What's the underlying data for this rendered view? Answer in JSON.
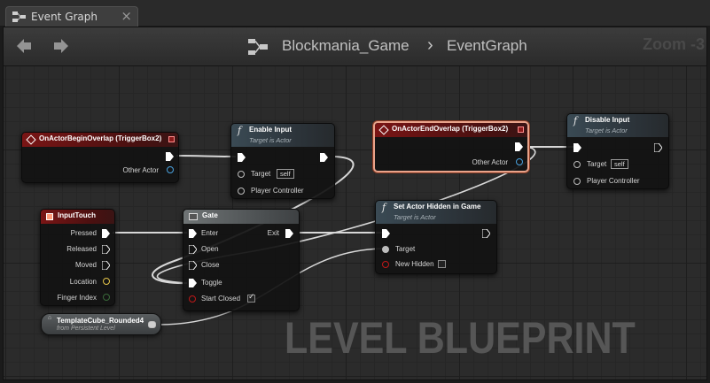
{
  "tab": {
    "label": "Event Graph",
    "icon": "event-graph-icon",
    "close": "×"
  },
  "header": {
    "breadcrumb_game": "Blockmania_Game",
    "breadcrumb_sep": "›",
    "breadcrumb_graph": "EventGraph",
    "zoom": "Zoom -3"
  },
  "watermark": "LEVEL BLUEPRINT",
  "nodes": {
    "on_begin_overlap": {
      "title": "OnActorBeginOverlap (TriggerBox2)",
      "pins": [
        "Other Actor"
      ]
    },
    "enable_input": {
      "title": "Enable Input",
      "subtitle": "Target is Actor",
      "pins": [
        "Target",
        "self",
        "Player Controller"
      ]
    },
    "on_end_overlap": {
      "title": "OnActorEndOverlap (TriggerBox2)",
      "pins": [
        "Other Actor"
      ]
    },
    "disable_input": {
      "title": "Disable Input",
      "subtitle": "Target is Actor",
      "pins": [
        "Target",
        "self",
        "Player Controller"
      ]
    },
    "input_touch": {
      "title": "InputTouch",
      "pins": [
        "Pressed",
        "Released",
        "Moved",
        "Location",
        "Finger Index"
      ]
    },
    "gate": {
      "title": "Gate",
      "pins": [
        "Enter",
        "Exit",
        "Open",
        "Close",
        "Toggle",
        "Start Closed"
      ],
      "start_closed": true
    },
    "set_hidden": {
      "title": "Set Actor Hidden in Game",
      "subtitle": "Target is Actor",
      "pins": [
        "Target",
        "New Hidden"
      ],
      "new_hidden": false
    },
    "template_cube": {
      "title": "TemplateCube_Rounded4",
      "subtitle": "from Persistent Level"
    }
  },
  "colors": {
    "event_header": "#7a1515",
    "function_header": "#3a4a54",
    "selection": "#e8a38a",
    "wire_exec": "#d8d8d8",
    "wire_object": "#3fa8e8"
  }
}
